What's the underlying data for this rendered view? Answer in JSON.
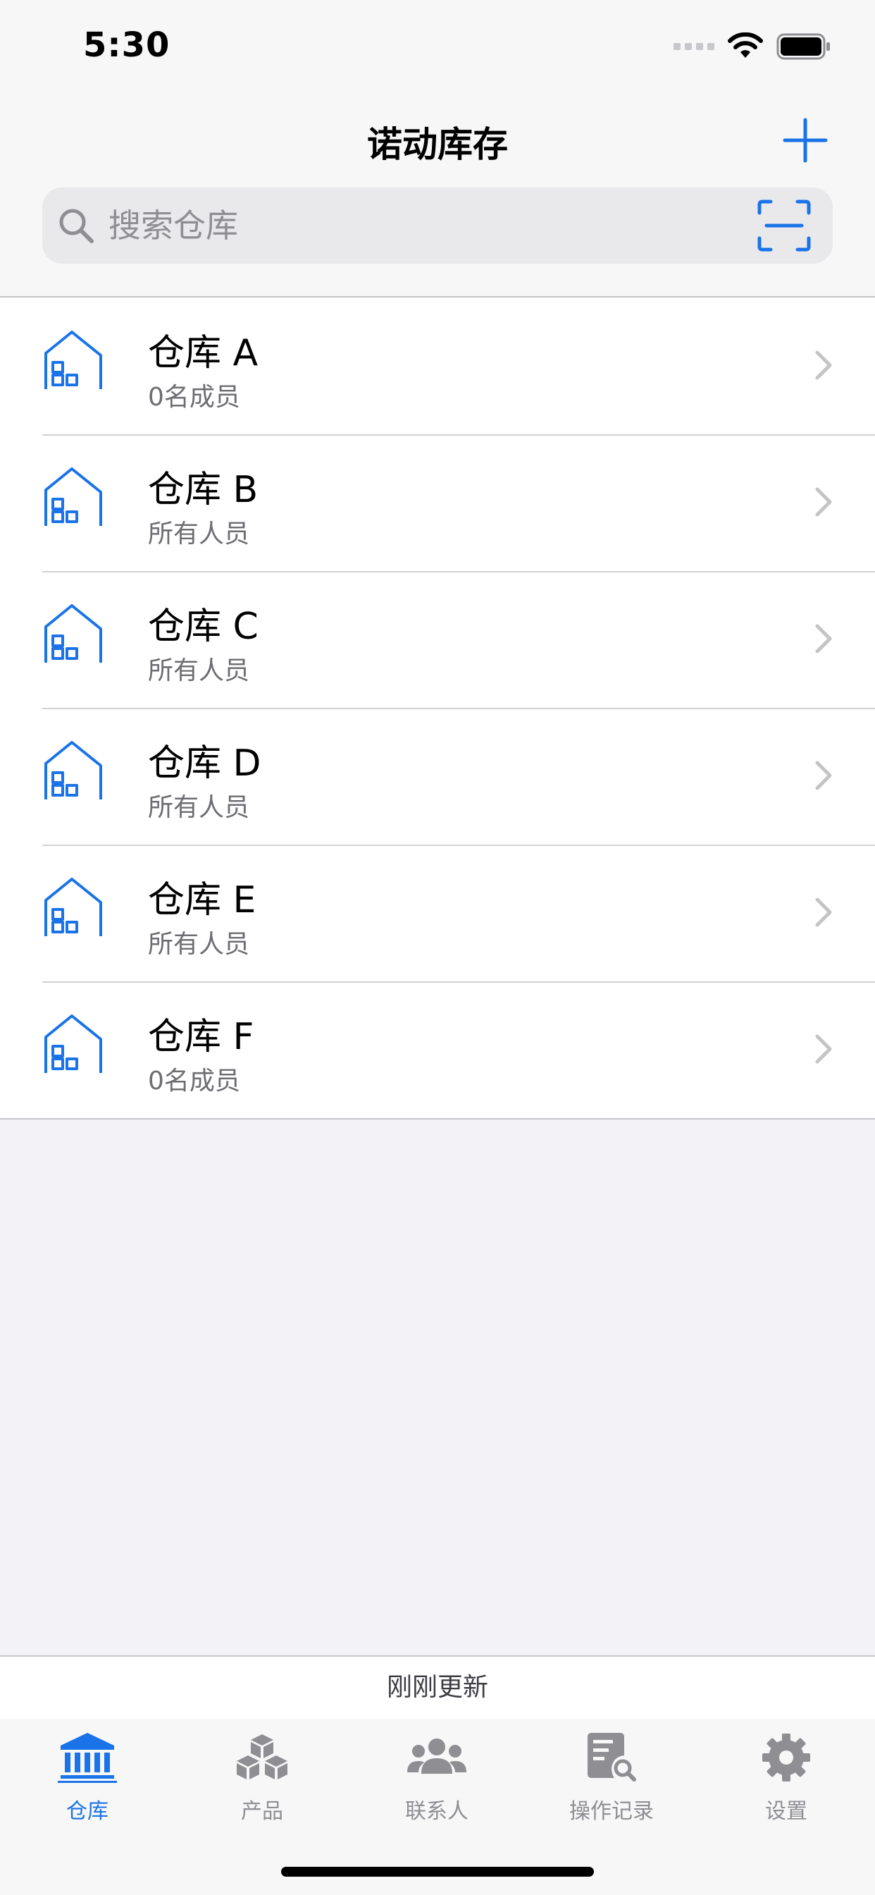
{
  "status_bar": {
    "time": "5:30"
  },
  "header": {
    "title": "诺动库存"
  },
  "search": {
    "placeholder": "搜索仓库",
    "value": ""
  },
  "warehouses": [
    {
      "name": "仓库 A",
      "subtitle": "0名成员"
    },
    {
      "name": "仓库 B",
      "subtitle": "所有人员"
    },
    {
      "name": "仓库 C",
      "subtitle": "所有人员"
    },
    {
      "name": "仓库 D",
      "subtitle": "所有人员"
    },
    {
      "name": "仓库 E",
      "subtitle": "所有人员"
    },
    {
      "name": "仓库 F",
      "subtitle": "0名成员"
    }
  ],
  "footer": {
    "updated_text": "刚刚更新"
  },
  "tabs": [
    {
      "label": "仓库",
      "icon": "bank-icon",
      "active": true
    },
    {
      "label": "产品",
      "icon": "boxes-icon",
      "active": false
    },
    {
      "label": "联系人",
      "icon": "people-icon",
      "active": false
    },
    {
      "label": "操作记录",
      "icon": "document-search-icon",
      "active": false
    },
    {
      "label": "设置",
      "icon": "gear-icon",
      "active": false
    }
  ],
  "colors": {
    "accent": "#1a73e8",
    "inactive": "#8e8e93",
    "background": "#f2f2f7"
  }
}
